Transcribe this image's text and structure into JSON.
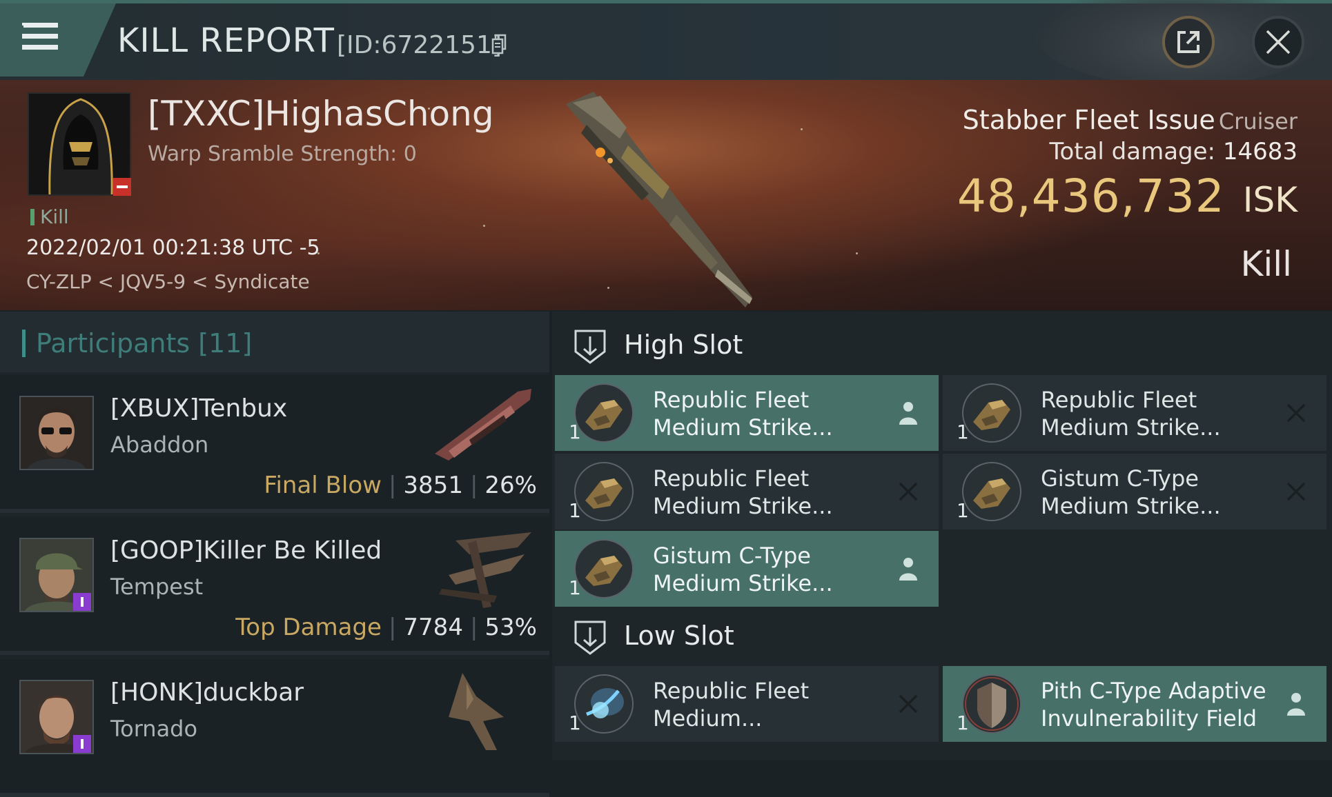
{
  "header": {
    "title": "KILL REPORT",
    "report_id": "[ID:6722151]",
    "icons": {
      "menu": "hamburger-icon",
      "copy": "copy-icon",
      "share": "share-icon",
      "close": "close-icon"
    }
  },
  "victim": {
    "name": "[TXXC]HighasChong",
    "warp_scramble": "Warp Sramble Strength: 0",
    "kill_label": "Kill",
    "timestamp": "2022/02/01 00:21:38 UTC -5",
    "location": "CY-ZLP < JQV5-9 < Syndicate",
    "ship_name": "Stabber Fleet Issue",
    "ship_class": "Cruiser",
    "total_damage_label": "Total damage:",
    "total_damage": "14683",
    "isk_value": "48,436,732",
    "currency": "ISK",
    "result": "Kill"
  },
  "participants": {
    "title": "Participants [11]",
    "rows": [
      {
        "name": "[XBUX]Tenbux",
        "ship": "Abaddon",
        "tag": "Final Blow",
        "damage": "3851",
        "percent": "26%",
        "badge": false
      },
      {
        "name": "[GOOP]Killer Be Killed",
        "ship": "Tempest",
        "tag": "Top Damage",
        "damage": "7784",
        "percent": "53%",
        "badge": true
      },
      {
        "name": "[HONK]duckbar",
        "ship": "Tornado",
        "tag": "",
        "damage": "",
        "percent": "",
        "badge": true
      }
    ]
  },
  "fitting": {
    "high_slot": {
      "title": "High Slot",
      "modules": [
        {
          "line1": "Republic Fleet",
          "line2": "Medium Strike...",
          "qty": "1",
          "status": "fitted"
        },
        {
          "line1": "Republic Fleet",
          "line2": "Medium Strike...",
          "qty": "1",
          "status": "destroyed"
        },
        {
          "line1": "Republic Fleet",
          "line2": "Medium Strike...",
          "qty": "1",
          "status": "destroyed"
        },
        {
          "line1": "Gistum C-Type",
          "line2": "Medium Strike...",
          "qty": "1",
          "status": "destroyed"
        },
        {
          "line1": "Gistum C-Type",
          "line2": "Medium Strike...",
          "qty": "1",
          "status": "fitted"
        }
      ]
    },
    "low_slot": {
      "title": "Low Slot",
      "modules": [
        {
          "line1": "Republic Fleet",
          "line2": "Medium...",
          "qty": "1",
          "status": "destroyed"
        },
        {
          "line1": "Pith C-Type Adaptive",
          "line2": "Invulnerability Field",
          "qty": "1",
          "status": "fitted"
        }
      ]
    }
  },
  "colors": {
    "accent_teal": "#477069",
    "isk_gold": "#e9c77d",
    "tag_gold": "#c8a862",
    "badge_red": "#c8302a",
    "badge_purple": "#8a3cd0"
  }
}
